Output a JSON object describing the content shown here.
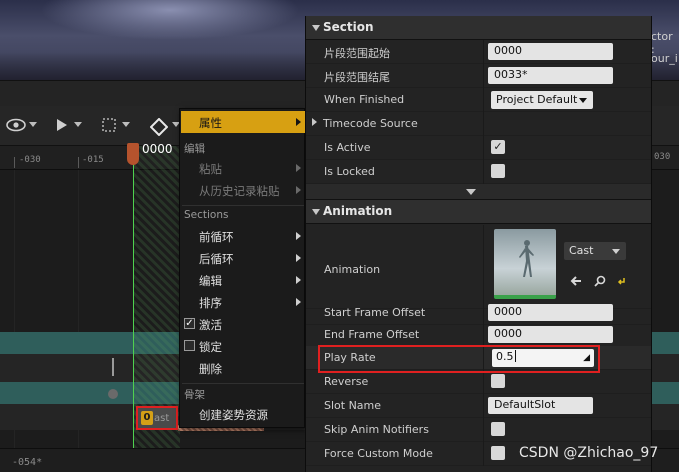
{
  "timeline": {
    "frame_readout": "0000",
    "ruler_labels": [
      "-030",
      "-015"
    ],
    "right_ruler_label": "030",
    "bottom_time": "-054*",
    "section_key_badge": "0",
    "section_key_label": "ast"
  },
  "viewport_fragments": {
    "line1": "ctor :",
    "line2": "our_i"
  },
  "context_menu": {
    "properties": "属性",
    "edit_header": "编辑",
    "paste": "粘贴",
    "paste_from_history": "从历史记录粘贴",
    "sections_header": "Sections",
    "pre_loop": "前循环",
    "post_loop": "后循环",
    "edit": "编辑",
    "order": "排序",
    "activate": "激活",
    "lock": "锁定",
    "delete": "删除",
    "skeleton_header": "骨架",
    "create_pose_asset": "创建姿势资源",
    "activate_checked": true,
    "lock_checked": false
  },
  "details": {
    "section_category": "Section",
    "range_start_label": "片段范围起始",
    "range_start_value": "0000",
    "range_end_label": "片段范围结尾",
    "range_end_value": "0033*",
    "when_finished_label": "When Finished",
    "when_finished_value": "Project Default",
    "timecode_label": "Timecode Source",
    "is_active_label": "Is Active",
    "is_active": true,
    "is_locked_label": "Is Locked",
    "is_locked": false,
    "animation_category": "Animation",
    "animation_label": "Animation",
    "animation_asset": "Cast",
    "start_offset_label": "Start Frame Offset",
    "start_offset_value": "0000",
    "end_offset_label": "End Frame Offset",
    "end_offset_value": "0000",
    "play_rate_label": "Play Rate",
    "play_rate_value": "0.5",
    "reverse_label": "Reverse",
    "reverse": false,
    "slot_name_label": "Slot Name",
    "slot_name_value": "DefaultSlot",
    "skip_notifiers_label": "Skip Anim Notifiers",
    "skip_notifiers": false,
    "force_custom_label": "Force Custom Mode",
    "force_custom": false
  },
  "watermark": "CSDN @Zhichao_97",
  "colors": {
    "menu_highlight": "#d7a012",
    "annotation_red": "#e02020",
    "playhead_green": "#4fd24f",
    "track_teal": "#2f5e5b"
  },
  "icons": [
    "eye-icon",
    "play-icon",
    "marquee-select-icon",
    "key-diamond-icon",
    "browse-arrow-icon",
    "search-icon",
    "reset-icon",
    "check-icon"
  ]
}
